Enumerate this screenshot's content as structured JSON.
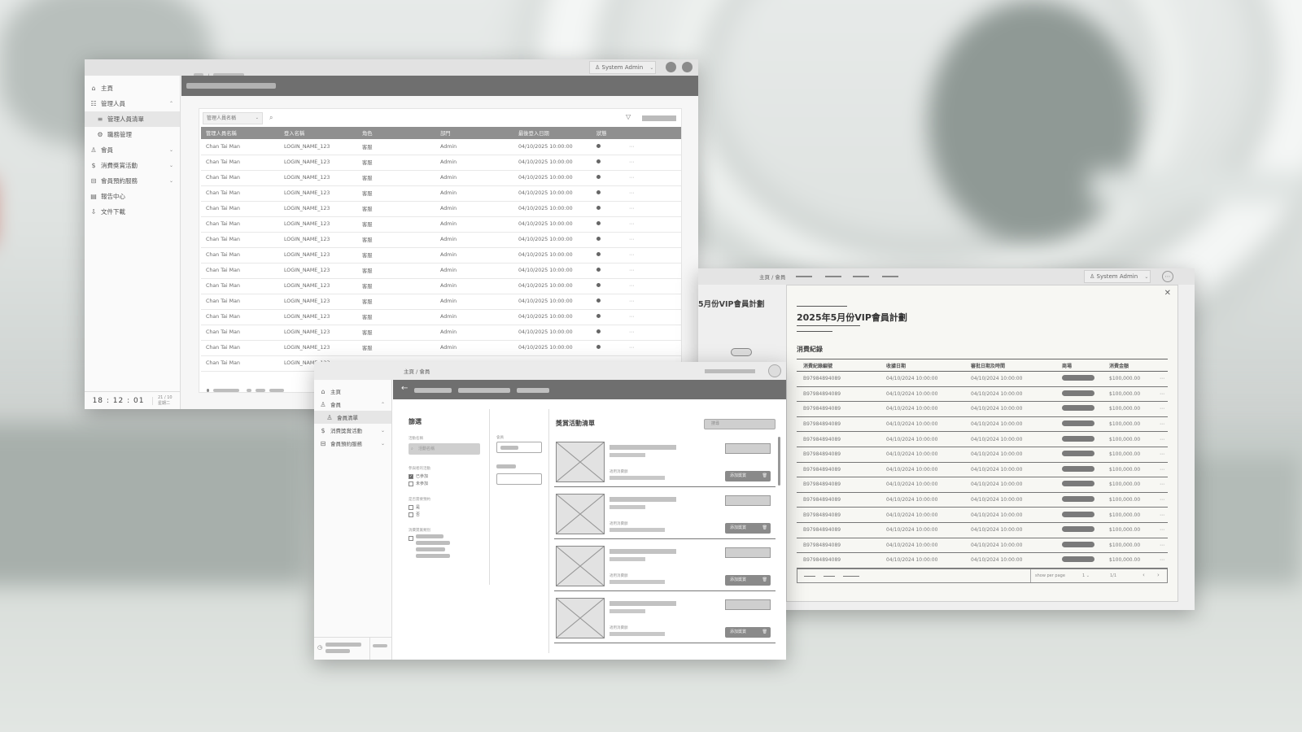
{
  "admin_window": {
    "user_label": "System Admin",
    "sidebar": [
      {
        "label": "主頁",
        "icon": "home-icon",
        "glyph": "⌂"
      },
      {
        "label": "管理人員",
        "icon": "admin-icon",
        "glyph": "☷",
        "chevron": "⌃"
      },
      {
        "label": "管理人員清單",
        "icon": "list-icon",
        "glyph": "≡",
        "active": true
      },
      {
        "label": "職務管理",
        "icon": "role-icon",
        "glyph": "⚙"
      },
      {
        "label": "會員",
        "icon": "member-icon",
        "glyph": "♙",
        "chevron": "⌄"
      },
      {
        "label": "消費獎賞活動",
        "icon": "dollar-icon",
        "glyph": "$",
        "chevron": "⌄"
      },
      {
        "label": "會員預約服務",
        "icon": "ticket-icon",
        "glyph": "⊟",
        "chevron": "⌄"
      },
      {
        "label": "報告中心",
        "icon": "report-icon",
        "glyph": "▤"
      },
      {
        "label": "文件下載",
        "icon": "download-icon",
        "glyph": "⇩"
      }
    ],
    "clock": "18 : 12 : 01",
    "date_line1": "21 / 10",
    "date_line2": "星期二",
    "filter_select": "管理人員名稱",
    "columns": [
      "管理人員名稱",
      "登入名稱",
      "角色",
      "部門",
      "最後登入日期",
      "狀態",
      ""
    ],
    "rows": [
      [
        "Chan Tai Man",
        "LOGIN_NAME_123",
        "客服",
        "Admin",
        "04/10/2025 10:00:00"
      ],
      [
        "Chan Tai Man",
        "LOGIN_NAME_123",
        "客服",
        "Admin",
        "04/10/2025 10:00:00"
      ],
      [
        "Chan Tai Man",
        "LOGIN_NAME_123",
        "客服",
        "Admin",
        "04/10/2025 10:00:00"
      ],
      [
        "Chan Tai Man",
        "LOGIN_NAME_123",
        "客服",
        "Admin",
        "04/10/2025 10:00:00"
      ],
      [
        "Chan Tai Man",
        "LOGIN_NAME_123",
        "客服",
        "Admin",
        "04/10/2025 10:00:00"
      ],
      [
        "Chan Tai Man",
        "LOGIN_NAME_123",
        "客服",
        "Admin",
        "04/10/2025 10:00:00"
      ],
      [
        "Chan Tai Man",
        "LOGIN_NAME_123",
        "客服",
        "Admin",
        "04/10/2025 10:00:00"
      ],
      [
        "Chan Tai Man",
        "LOGIN_NAME_123",
        "客服",
        "Admin",
        "04/10/2025 10:00:00"
      ],
      [
        "Chan Tai Man",
        "LOGIN_NAME_123",
        "客服",
        "Admin",
        "04/10/2025 10:00:00"
      ],
      [
        "Chan Tai Man",
        "LOGIN_NAME_123",
        "客服",
        "Admin",
        "04/10/2025 10:00:00"
      ],
      [
        "Chan Tai Man",
        "LOGIN_NAME_123",
        "客服",
        "Admin",
        "04/10/2025 10:00:00"
      ],
      [
        "Chan Tai Man",
        "LOGIN_NAME_123",
        "客服",
        "Admin",
        "04/10/2025 10:00:00"
      ],
      [
        "Chan Tai Man",
        "LOGIN_NAME_123",
        "客服",
        "Admin",
        "04/10/2025 10:00:00"
      ],
      [
        "Chan Tai Man",
        "LOGIN_NAME_123",
        "客服",
        "Admin",
        "04/10/2025 10:00:00"
      ],
      [
        "Chan Tai Man",
        "LOGIN_NAME_123",
        "",
        "",
        ""
      ]
    ]
  },
  "member_window": {
    "breadcrumb": "主頁 / 會員",
    "user_label": "System Admin",
    "behind_title": "5月份VIP會員計劃",
    "modal_title": "2025年5月份VIP會員計劃",
    "section_title": "消費紀錄",
    "columns": [
      "消費紀錄編號",
      "收據日期",
      "審批日期及時間",
      "商場",
      "消費金額",
      ""
    ],
    "rows": [
      [
        "B97984894089",
        "04/10/2024 10:00:00",
        "04/10/2024 10:00:00",
        "$100,000.00"
      ],
      [
        "B97984894089",
        "04/10/2024 10:00:00",
        "04/10/2024 10:00:00",
        "$100,000.00"
      ],
      [
        "B97984894089",
        "04/10/2024 10:00:00",
        "04/10/2024 10:00:00",
        "$100,000.00"
      ],
      [
        "B97984894089",
        "04/10/2024 10:00:00",
        "04/10/2024 10:00:00",
        "$100,000.00"
      ],
      [
        "B97984894089",
        "04/10/2024 10:00:00",
        "04/10/2024 10:00:00",
        "$100,000.00"
      ],
      [
        "B97984894089",
        "04/10/2024 10:00:00",
        "04/10/2024 10:00:00",
        "$100,000.00"
      ],
      [
        "B97984894089",
        "04/10/2024 10:00:00",
        "04/10/2024 10:00:00",
        "$100,000.00"
      ],
      [
        "B97984894089",
        "04/10/2024 10:00:00",
        "04/10/2024 10:00:00",
        "$100,000.00"
      ],
      [
        "B97984894089",
        "04/10/2024 10:00:00",
        "04/10/2024 10:00:00",
        "$100,000.00"
      ],
      [
        "B97984894089",
        "04/10/2024 10:00:00",
        "04/10/2024 10:00:00",
        "$100,000.00"
      ],
      [
        "B97984894089",
        "04/10/2024 10:00:00",
        "04/10/2024 10:00:00",
        "$100,000.00"
      ],
      [
        "B97984894089",
        "04/10/2024 10:00:00",
        "04/10/2024 10:00:00",
        "$100,000.00"
      ],
      [
        "B97984894089",
        "04/10/2024 10:00:00",
        "04/10/2024 10:00:00",
        "$100,000.00"
      ]
    ],
    "pager": {
      "show_per_page": "show per page",
      "per_page": "1",
      "range": "1/1"
    }
  },
  "activity_window": {
    "breadcrumb": "主頁 / 會員",
    "sidebar": [
      {
        "label": "主頁",
        "icon": "home-icon",
        "glyph": "⌂"
      },
      {
        "label": "會員",
        "icon": "member-icon",
        "glyph": "♙",
        "chevron": "⌃"
      },
      {
        "label": "會員清單",
        "icon": "member-list-icon",
        "glyph": "♙",
        "active": true
      },
      {
        "label": "消費獎賞活動",
        "icon": "dollar-icon",
        "glyph": "$",
        "chevron": "⌄"
      },
      {
        "label": "會員預約服務",
        "icon": "ticket-icon",
        "glyph": "⊟",
        "chevron": "⌄"
      }
    ],
    "filter_title": "篩選",
    "filter_label1": "活動名稱",
    "search_placeholder": "活動名稱",
    "filter_label2": "參與者的活動",
    "cb_options_a": [
      "已參加",
      "未參加"
    ],
    "filter_label3": "是否需要預約",
    "cb_options_b": [
      "是",
      "否"
    ],
    "filter_label4": "消費獎賞類別",
    "mid_label": "會員",
    "list_title": "獎賞活動清單",
    "list_search": "搜尋",
    "card_label": "適用消費額",
    "card_buttons": [
      "添加獎賞",
      "添加獎賞",
      "添加獎賞",
      "添加獎賞"
    ]
  }
}
